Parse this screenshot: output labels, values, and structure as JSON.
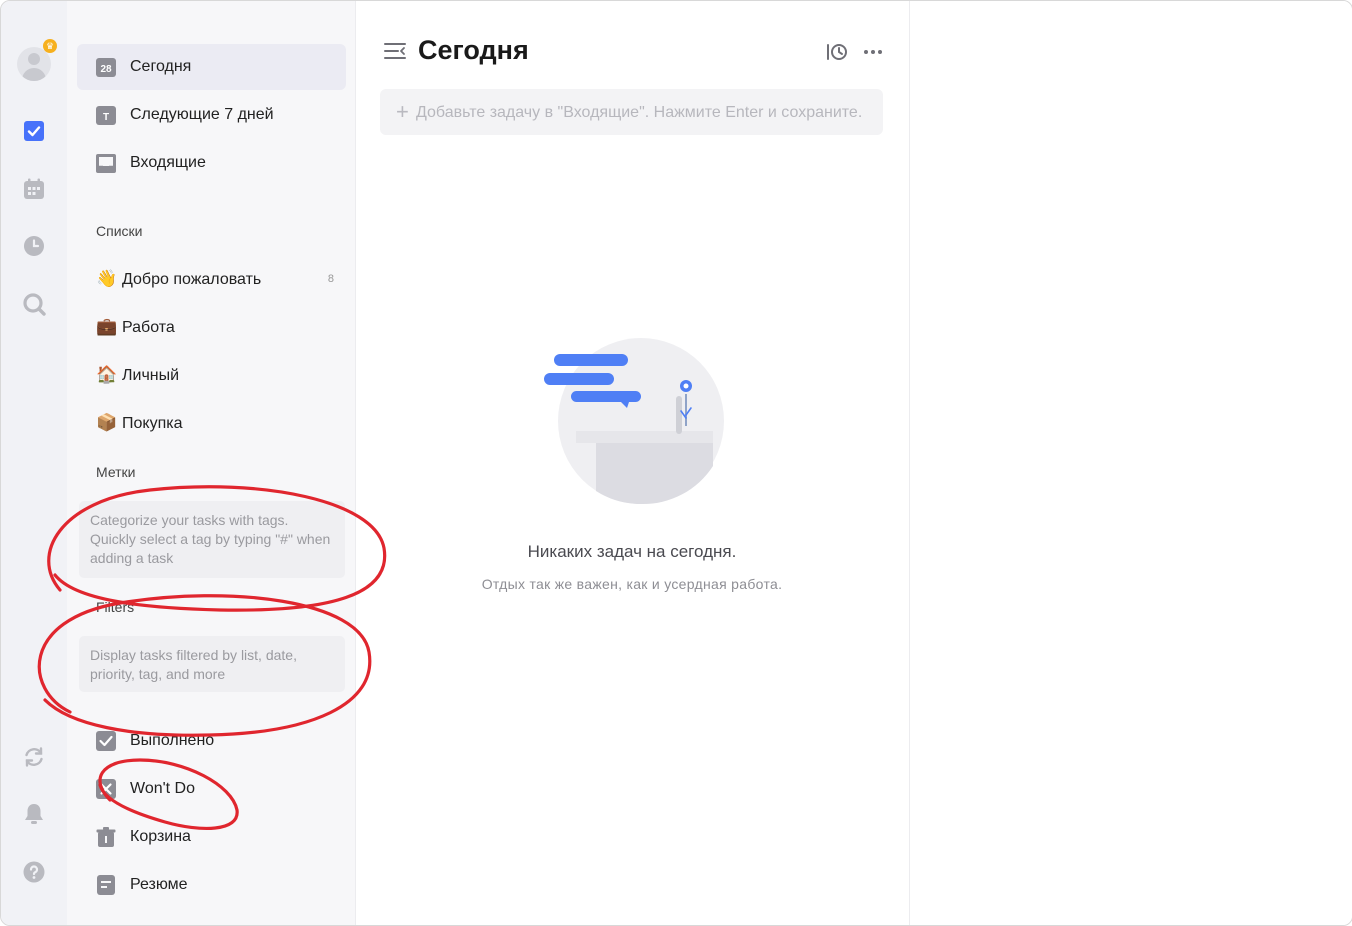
{
  "user": {
    "badge_icon": "crown-icon"
  },
  "rail": {
    "icons": [
      "checkbox-icon",
      "calendar-icon",
      "clock-icon",
      "search-icon",
      "sync-icon",
      "bell-icon",
      "help-icon"
    ]
  },
  "nav": {
    "today": {
      "label": "Сегодня",
      "day": "28"
    },
    "next7": {
      "label": "Следующие 7 дней",
      "badge": "T"
    },
    "inbox": {
      "label": "Входящие"
    }
  },
  "lists": {
    "title": "Списки",
    "items": [
      {
        "emoji": "👋",
        "label": "Добро пожаловать",
        "count": "8"
      },
      {
        "emoji": "💼",
        "label": "Работа",
        "count": ""
      },
      {
        "emoji": "🏠",
        "label": "Личный",
        "count": ""
      },
      {
        "emoji": "📦",
        "label": "Покупка",
        "count": ""
      }
    ]
  },
  "tags": {
    "title": "Метки",
    "hint": "Categorize your tasks with tags. Quickly select a tag by typing \"#\" when adding a task"
  },
  "filters": {
    "title": "Filters",
    "hint": "Display tasks filtered by list, date, priority, tag, and more"
  },
  "bottom_nav": {
    "completed": "Выполнено",
    "wont_do": "Won't Do",
    "trash": "Корзина",
    "summary": "Резюме"
  },
  "main": {
    "title": "Сегодня",
    "add_task_placeholder": "Добавьте задачу в \"Входящие\". Нажмите Enter и сохраните.",
    "empty_title": "Никаких задач на сегодня.",
    "empty_subtitle": "Отдых так же важен, как и усердная работа."
  },
  "colors": {
    "accent": "#4772fa",
    "annotation": "#e0262e"
  }
}
